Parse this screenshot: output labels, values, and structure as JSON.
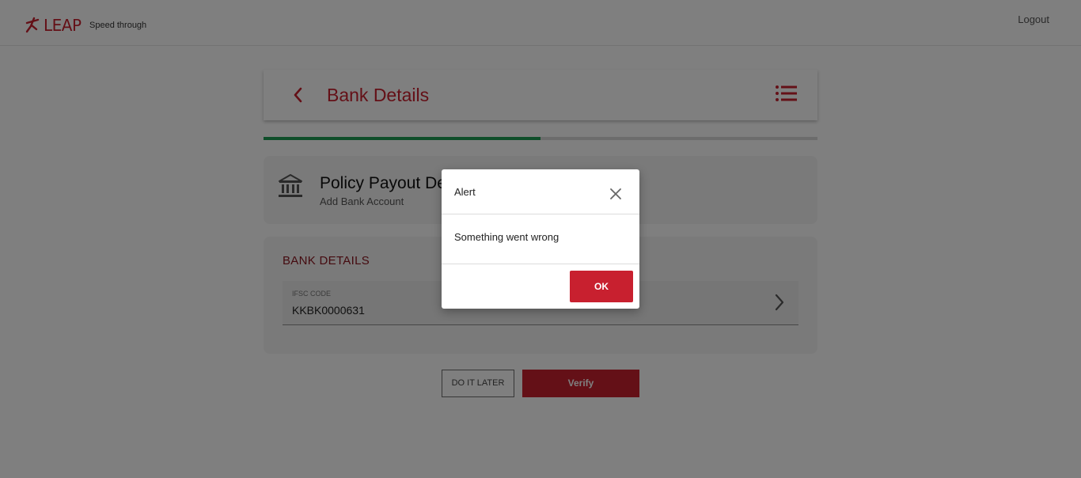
{
  "header": {
    "logo_text": "LEAP",
    "tagline": "Speed through",
    "logout_label": "Logout"
  },
  "title_bar": {
    "title": "Bank Details",
    "back_icon": "chevron-left-icon",
    "menu_icon": "list-menu-icon"
  },
  "progress": {
    "fraction": 0.5
  },
  "section": {
    "icon": "bank-icon",
    "title": "Policy Payout Details",
    "subtitle": "Add Bank Account"
  },
  "bank_details": {
    "heading": "BANK DETAILS",
    "ifsc": {
      "label": "IFSC CODE",
      "value": "KKBK0000631"
    }
  },
  "actions": {
    "later_label": "DO IT LATER",
    "verify_label": "Verify"
  },
  "modal": {
    "title": "Alert",
    "message": "Something went wrong",
    "ok_label": "OK"
  },
  "colors": {
    "brand_red": "#c8202f",
    "dark_red": "#8b1620",
    "progress_green": "#1f9d55"
  }
}
